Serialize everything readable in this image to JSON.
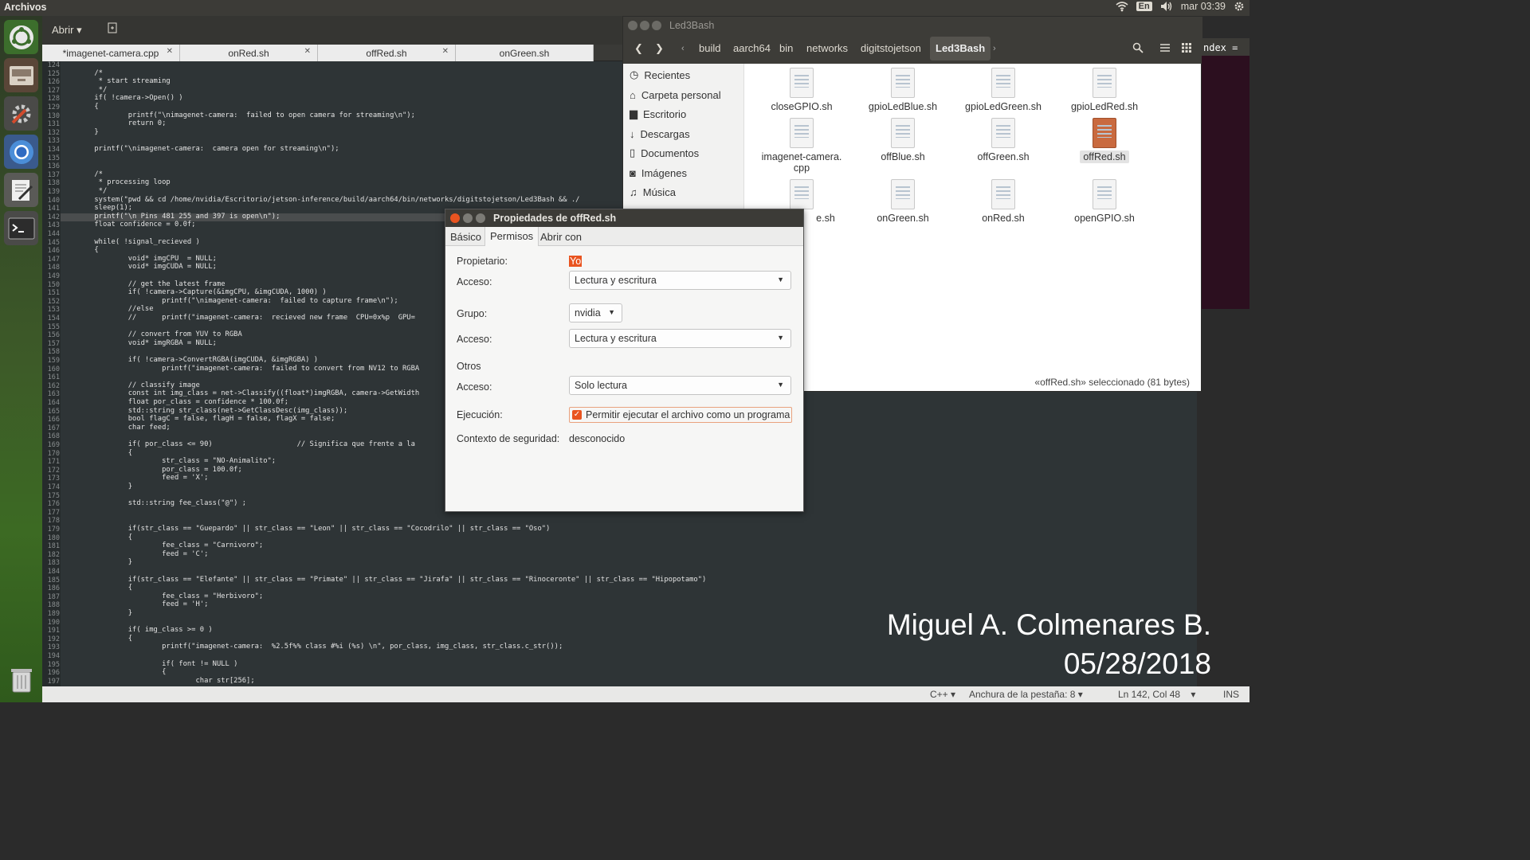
{
  "topbar": {
    "app_name": "Archivos",
    "lang": "En",
    "clock": "mar 03:39"
  },
  "gedit": {
    "open_label": "Abrir",
    "tabs": [
      {
        "label": "*imagenet-camera.cpp"
      },
      {
        "label": "onRed.sh"
      },
      {
        "label": "offRed.sh"
      },
      {
        "label": "onGreen.sh"
      }
    ],
    "lines": [
      {
        "n": "124",
        "t": ""
      },
      {
        "n": "125",
        "t": "        /*"
      },
      {
        "n": "126",
        "t": "         * start streaming"
      },
      {
        "n": "127",
        "t": "         */"
      },
      {
        "n": "128",
        "t": "        if( !camera->Open() )"
      },
      {
        "n": "129",
        "t": "        {"
      },
      {
        "n": "130",
        "t": "                printf(\"\\nimagenet-camera:  failed to open camera for streaming\\n\");"
      },
      {
        "n": "131",
        "t": "                return 0;"
      },
      {
        "n": "132",
        "t": "        }"
      },
      {
        "n": "133",
        "t": ""
      },
      {
        "n": "134",
        "t": "        printf(\"\\nimagenet-camera:  camera open for streaming\\n\");"
      },
      {
        "n": "135",
        "t": ""
      },
      {
        "n": "136",
        "t": ""
      },
      {
        "n": "137",
        "t": "        /*"
      },
      {
        "n": "138",
        "t": "         * processing loop"
      },
      {
        "n": "139",
        "t": "         */"
      },
      {
        "n": "140",
        "t": "        system(\"pwd && cd /home/nvidia/Escritorio/jetson-inference/build/aarch64/bin/networks/digitstojetson/Led3Bash && ./"
      },
      {
        "n": "141",
        "t": "        sleep(1);"
      },
      {
        "n": "142",
        "t": "        printf(\"\\n Pins 481 255 and 397 is open\\n\");"
      },
      {
        "n": "143",
        "t": "        float confidence = 0.0f;"
      },
      {
        "n": "144",
        "t": ""
      },
      {
        "n": "145",
        "t": "        while( !signal_recieved )"
      },
      {
        "n": "146",
        "t": "        {"
      },
      {
        "n": "147",
        "t": "                void* imgCPU  = NULL;"
      },
      {
        "n": "148",
        "t": "                void* imgCUDA = NULL;"
      },
      {
        "n": "149",
        "t": ""
      },
      {
        "n": "150",
        "t": "                // get the latest frame"
      },
      {
        "n": "151",
        "t": "                if( !camera->Capture(&imgCPU, &imgCUDA, 1000) )"
      },
      {
        "n": "152",
        "t": "                        printf(\"\\nimagenet-camera:  failed to capture frame\\n\");"
      },
      {
        "n": "153",
        "t": "                //else"
      },
      {
        "n": "154",
        "t": "                //      printf(\"imagenet-camera:  recieved new frame  CPU=0x%p  GPU="
      },
      {
        "n": "155",
        "t": ""
      },
      {
        "n": "156",
        "t": "                // convert from YUV to RGBA"
      },
      {
        "n": "157",
        "t": "                void* imgRGBA = NULL;"
      },
      {
        "n": "158",
        "t": ""
      },
      {
        "n": "159",
        "t": "                if( !camera->ConvertRGBA(imgCUDA, &imgRGBA) )"
      },
      {
        "n": "160",
        "t": "                        printf(\"imagenet-camera:  failed to convert from NV12 to RGBA"
      },
      {
        "n": "161",
        "t": ""
      },
      {
        "n": "162",
        "t": "                // classify image"
      },
      {
        "n": "163",
        "t": "                const int img_class = net->Classify((float*)imgRGBA, camera->GetWidth"
      },
      {
        "n": "164",
        "t": "                float por_class = confidence * 100.0f;"
      },
      {
        "n": "165",
        "t": "                std::string str_class(net->GetClassDesc(img_class));"
      },
      {
        "n": "166",
        "t": "                bool flagC = false, flagH = false, flagX = false;"
      },
      {
        "n": "167",
        "t": "                char feed;"
      },
      {
        "n": "168",
        "t": ""
      },
      {
        "n": "169",
        "t": "                if( por_class <= 90)                    // Significa que frente a la"
      },
      {
        "n": "170",
        "t": "                {"
      },
      {
        "n": "171",
        "t": "                        str_class = \"NO-Animalito\";"
      },
      {
        "n": "172",
        "t": "                        por_class = 100.0f;"
      },
      {
        "n": "173",
        "t": "                        feed = 'X';"
      },
      {
        "n": "174",
        "t": "                }"
      },
      {
        "n": "175",
        "t": ""
      },
      {
        "n": "176",
        "t": "                std::string fee_class(\"@\") ;"
      },
      {
        "n": "177",
        "t": ""
      },
      {
        "n": "178",
        "t": ""
      },
      {
        "n": "179",
        "t": "                if(str_class == \"Guepardo\" || str_class == \"Leon\" || str_class == \"Cocodrilo\" || str_class == \"Oso\")"
      },
      {
        "n": "180",
        "t": "                {"
      },
      {
        "n": "181",
        "t": "                        fee_class = \"Carnivoro\";"
      },
      {
        "n": "182",
        "t": "                        feed = 'C';"
      },
      {
        "n": "183",
        "t": "                }"
      },
      {
        "n": "184",
        "t": ""
      },
      {
        "n": "185",
        "t": "                if(str_class == \"Elefante\" || str_class == \"Primate\" || str_class == \"Jirafa\" || str_class == \"Rinoceronte\" || str_class == \"Hipopotamo\")"
      },
      {
        "n": "186",
        "t": "                {"
      },
      {
        "n": "187",
        "t": "                        fee_class = \"Herbivoro\";"
      },
      {
        "n": "188",
        "t": "                        feed = 'H';"
      },
      {
        "n": "189",
        "t": "                }"
      },
      {
        "n": "190",
        "t": ""
      },
      {
        "n": "191",
        "t": "                if( img_class >= 0 )"
      },
      {
        "n": "192",
        "t": "                {"
      },
      {
        "n": "193",
        "t": "                        printf(\"imagenet-camera:  %2.5f%% class #%i (%s) \\n\", por_class, img_class, str_class.c_str());"
      },
      {
        "n": "194",
        "t": ""
      },
      {
        "n": "195",
        "t": "                        if( font != NULL )"
      },
      {
        "n": "196",
        "t": "                        {"
      },
      {
        "n": "197",
        "t": "                                char str[256];"
      }
    ]
  },
  "status": {
    "lang": "C++",
    "tab_width": "Anchura de la pestaña: 8",
    "position": "Ln 142, Col 48",
    "mode": "INS"
  },
  "nautilus": {
    "title": "Led3Bash",
    "breadcrumbs": [
      "build",
      "aarch64",
      "bin",
      "networks",
      "digitstojetson",
      "Led3Bash"
    ],
    "sidebar": [
      {
        "label": "Recientes",
        "icon": "clock-icon"
      },
      {
        "label": "Carpeta personal",
        "icon": "home-icon"
      },
      {
        "label": "Escritorio",
        "icon": "folder-icon"
      },
      {
        "label": "Descargas",
        "icon": "download-icon"
      },
      {
        "label": "Documentos",
        "icon": "document-icon"
      },
      {
        "label": "Imágenes",
        "icon": "camera-icon"
      },
      {
        "label": "Música",
        "icon": "music-icon"
      }
    ],
    "files": [
      {
        "name": "closeGPIO.sh"
      },
      {
        "name": "gpioLedBlue.sh"
      },
      {
        "name": "gpioLedGreen.sh"
      },
      {
        "name": "gpioLedRed.sh"
      },
      {
        "name": "imagenet-camera.",
        "name2": "cpp"
      },
      {
        "name": "offBlue.sh"
      },
      {
        "name": "offGreen.sh"
      },
      {
        "name": "offRed.sh"
      },
      {
        "name": "e.sh"
      },
      {
        "name": "onGreen.sh"
      },
      {
        "name": "onRed.sh"
      },
      {
        "name": "openGPIO.sh"
      }
    ],
    "status": "«offRed.sh» seleccionado  (81 bytes)"
  },
  "terminal": {
    "text": "ndex ="
  },
  "dialog": {
    "title": "Propiedades de offRed.sh",
    "tabs": [
      "Básico",
      "Permisos",
      "Abrir con"
    ],
    "owner_label": "Propietario:",
    "owner_value": "Yo",
    "access_label": "Acceso:",
    "owner_access": "Lectura y escritura",
    "group_label": "Grupo:",
    "group_value": "nvidia",
    "group_access": "Lectura y escritura",
    "others_label": "Otros",
    "others_access": "Solo lectura",
    "exec_label": "Ejecución:",
    "exec_checkbox": "Permitir ejecutar el archivo como un programa",
    "context_label": "Contexto de seguridad:",
    "context_value": "desconocido"
  },
  "watermark": {
    "line1": "Miguel A. Colmenares B.",
    "line2": "05/28/2018"
  },
  "colors": {
    "accent": "#e95420",
    "panel": "#3c3b37",
    "code_bg": "#2e3436",
    "selected_file": "#c96a3f"
  }
}
